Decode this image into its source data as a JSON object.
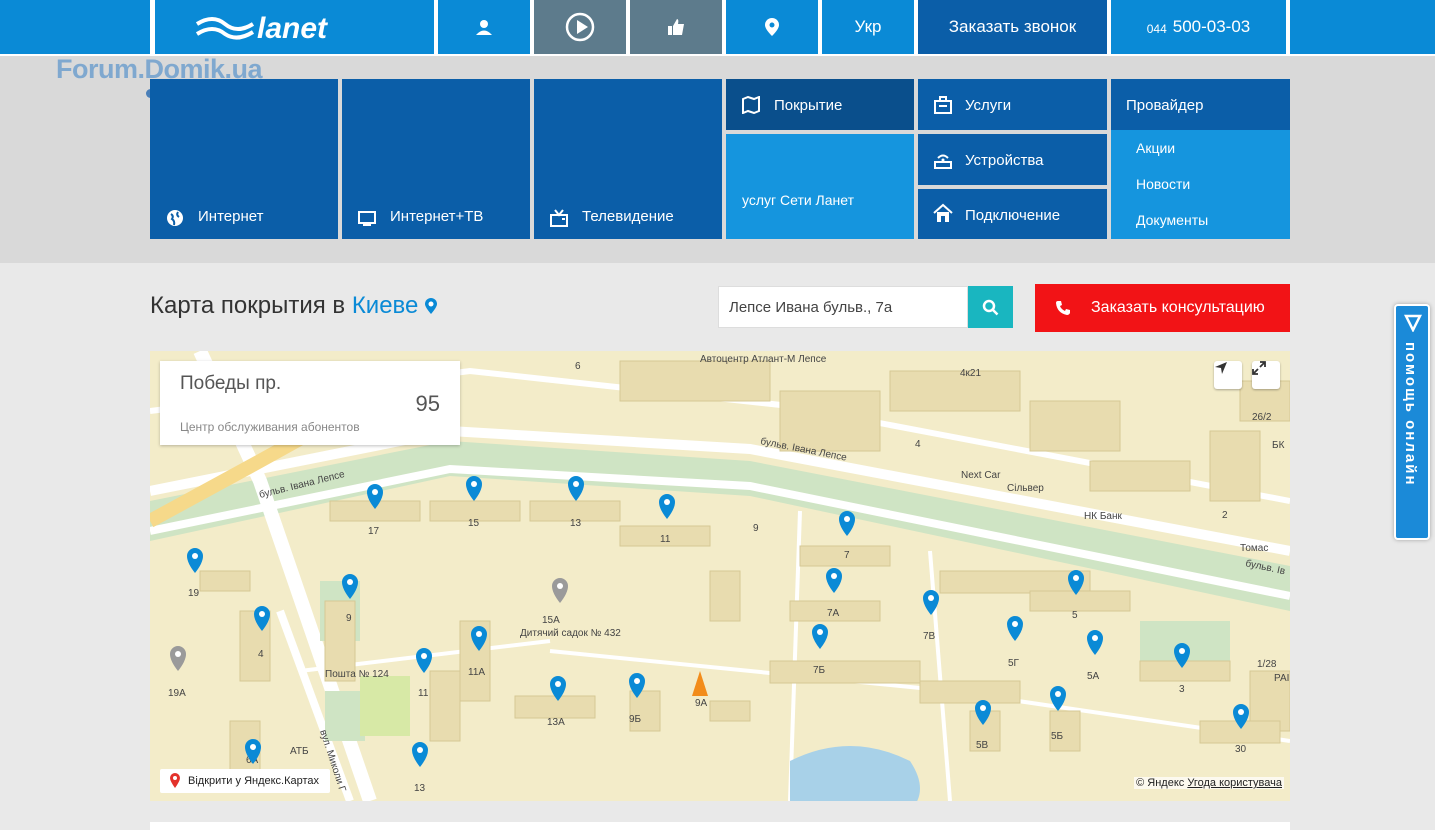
{
  "topbar": {
    "brand": "lanet",
    "lang": "Укр",
    "callback": "Заказать звонок",
    "phone_prefix": "044",
    "phone": "500-03-03",
    "icons": [
      "user-icon",
      "play-icon",
      "thumbs-up-icon",
      "location-pin-icon"
    ]
  },
  "watermark": "Forum.Domik.ua",
  "tiles": {
    "internet": "Интернет",
    "internet_tv": "Интернет+ТВ",
    "tv": "Телевидение",
    "coverage": "Покрытие",
    "coverage_sub": "услуг Сети Ланет",
    "services": "Услуги",
    "devices": "Устройства",
    "connection": "Подключение",
    "provider": "Провайдер",
    "provider_items": [
      "Акции",
      "Новости",
      "Документы"
    ]
  },
  "page": {
    "title_prefix": "Карта покрытия в",
    "city": "Киеве"
  },
  "search": {
    "value": "Лепсе Ивана бульв., 7а"
  },
  "consult_button": "Заказать консультацию",
  "infobox": {
    "title": "Победы пр.",
    "subtitle": "Центр обслуживания абонентов",
    "number": "95"
  },
  "map": {
    "open_in_yandex": "Відкрити у Яндекс.Картах",
    "copyright": "© Яндекс",
    "terms": "Угода користувача",
    "street_labels": [
      "бульв. Івана Лепсе",
      "бульв. Івана Лепсе",
      "бульв. Ів",
      "вул. Миколи Г"
    ],
    "poi": [
      "Автоцентр Атлант-М Лепсе",
      "Next Car",
      "Сільвер",
      "НК Банк",
      "Томас",
      "Дитячий садок № 432",
      "Пошта № 124",
      "АТБ",
      "БК",
      "РАІ"
    ],
    "house_numbers": [
      "17",
      "15",
      "13",
      "11",
      "9",
      "7",
      "19",
      "9",
      "7А",
      "7В",
      "5",
      "4",
      "11А",
      "15А",
      "5Г",
      "5А",
      "3",
      "19А",
      "11",
      "13А",
      "9Б",
      "9А",
      "7Б",
      "5В",
      "5Б",
      "30",
      "6А",
      "13",
      "4к21",
      "6",
      "4",
      "2",
      "26/2",
      "1/28"
    ]
  },
  "help_widget": "помощь онлайн",
  "colors": {
    "brand_blue": "#0a8ad6",
    "navy": "#0b5ea8",
    "red": "#f21316",
    "teal": "#19b6c0"
  }
}
